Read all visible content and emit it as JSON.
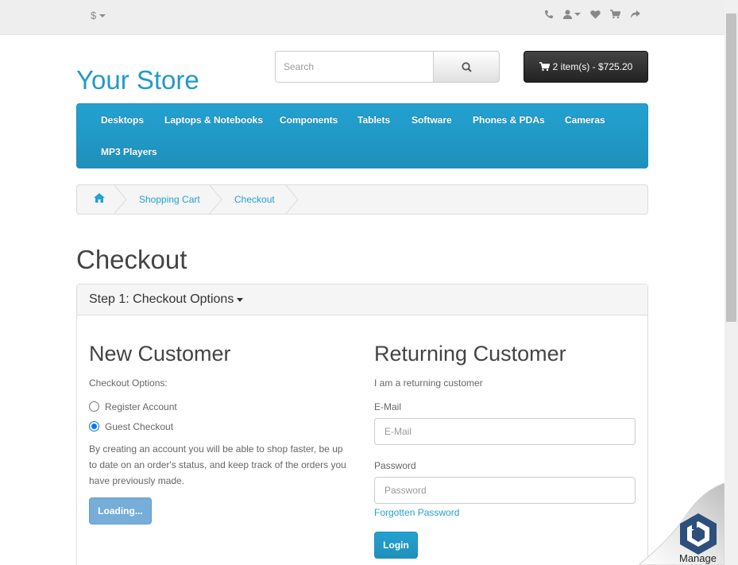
{
  "topbar": {
    "currency_symbol": "$",
    "icons": [
      "phone-icon",
      "user-icon",
      "heart-icon",
      "cart-icon",
      "share-icon"
    ]
  },
  "header": {
    "logo": "Your Store",
    "search_placeholder": "Search",
    "cart_label": "2 item(s) - $725.20"
  },
  "menu": {
    "items": [
      "Desktops",
      "Laptops & Notebooks",
      "Components",
      "Tablets",
      "Software",
      "Phones & PDAs",
      "Cameras",
      "MP3 Players"
    ]
  },
  "breadcrumb": {
    "items": [
      "Shopping Cart",
      "Checkout"
    ]
  },
  "page": {
    "title": "Checkout"
  },
  "panel": {
    "heading": "Step 1: Checkout Options"
  },
  "new_customer": {
    "title": "New Customer",
    "options_label": "Checkout Options:",
    "register_label": "Register Account",
    "guest_label": "Guest Checkout",
    "selected": "Guest Checkout",
    "description": "By creating an account you will be able to shop faster, be up to date on an order's status, and keep track of the orders you have previously made.",
    "button": "Loading..."
  },
  "returning_customer": {
    "title": "Returning Customer",
    "subtitle": "I am a returning customer",
    "email_label": "E-Mail",
    "email_placeholder": "E-Mail",
    "password_label": "Password",
    "password_placeholder": "Password",
    "forgotten_link": "Forgotten Password",
    "login_button": "Login"
  },
  "widget": {
    "label": "Manage"
  },
  "colors": {
    "accent": "#229ac8",
    "menu_bg": "#229ac8",
    "cart_bg": "#333333",
    "loading_btn": "#6fa9d8"
  }
}
